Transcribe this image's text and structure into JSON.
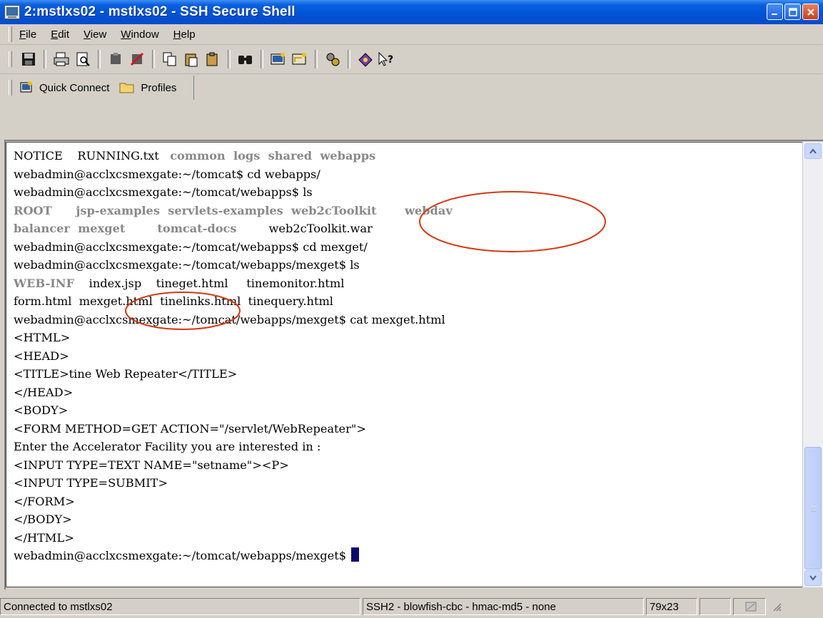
{
  "window": {
    "title": "2:mstlxs02 - mstlxs02 - SSH Secure Shell",
    "buttons": [
      "minimize",
      "maximize",
      "close"
    ]
  },
  "menu": [
    {
      "label": "File",
      "mnemonic": "F",
      "rest": "ile"
    },
    {
      "label": "Edit",
      "mnemonic": "E",
      "rest": "dit"
    },
    {
      "label": "View",
      "mnemonic": "V",
      "rest": "iew"
    },
    {
      "label": "Window",
      "mnemonic": "W",
      "rest": "indow"
    },
    {
      "label": "Help",
      "mnemonic": "H",
      "rest": "elp"
    }
  ],
  "toolbar_icons": [
    "save-icon",
    "print-icon",
    "print-preview-icon",
    "disconnect-icon",
    "terminate-icon",
    "copy-icon",
    "paste-icon",
    "paste-special-icon",
    "find-icon",
    "new-terminal-icon",
    "new-file-transfer-icon",
    "settings-icon",
    "help-icon",
    "context-help-icon"
  ],
  "quick_connect": {
    "quick_connect_label": "Quick Connect",
    "profiles_label": "Profiles"
  },
  "terminal": {
    "lines": [
      [
        {
          "t": "NOTICE    RUNNING.txt   "
        },
        {
          "t": "common  logs  shared  webapps",
          "c": "gray"
        }
      ],
      [
        {
          "t": "webadmin@acclxcsmexgate:~/tomcat$ cd webapps/"
        }
      ],
      [
        {
          "t": "webadmin@acclxcsmexgate:~/tomcat/webapps$ ls"
        }
      ],
      [
        {
          "t": "ROOT      jsp-examples  servlets-examples  web2cToolkit       webdav",
          "c": "gray"
        }
      ],
      [
        {
          "t": "balancer  mexget        tomcat-docs        ",
          "c": "gray"
        },
        {
          "t": "web2cToolkit.war"
        }
      ],
      [
        {
          "t": "webadmin@acclxcsmexgate:~/tomcat/webapps$ cd mexget/"
        }
      ],
      [
        {
          "t": "webadmin@acclxcsmexgate:~/tomcat/webapps/mexget$ ls"
        }
      ],
      [
        {
          "t": "WEB-INF",
          "c": "gray"
        },
        {
          "t": "    index.jsp    tineget.html     tinemonitor.html"
        }
      ],
      [
        {
          "t": "form.html  mexget.html  tinelinks.html  tinequery.html"
        }
      ],
      [
        {
          "t": "webadmin@acclxcsmexgate:~/tomcat/webapps/mexget$ cat mexget.html"
        }
      ],
      [
        {
          "t": "<HTML>"
        }
      ],
      [
        {
          "t": "<HEAD>"
        }
      ],
      [
        {
          "t": "<TITLE>tine Web Repeater</TITLE>"
        }
      ],
      [
        {
          "t": "</HEAD>"
        }
      ],
      [
        {
          "t": "<BODY>"
        }
      ],
      [
        {
          "t": "<FORM METHOD=GET ACTION=\"/servlet/WebRepeater\">"
        }
      ],
      [
        {
          "t": "Enter the Accelerator Facility you are interested in :"
        }
      ],
      [
        {
          "t": "<INPUT TYPE=TEXT NAME=\"setname\"><P>"
        }
      ],
      [
        {
          "t": "<INPUT TYPE=SUBMIT>"
        }
      ],
      [
        {
          "t": "</FORM>"
        }
      ],
      [
        {
          "t": "</BODY>"
        }
      ],
      [
        {
          "t": "</HTML>"
        }
      ],
      [
        {
          "t": "webadmin@acclxcsmexgate:~/tomcat/webapps/mexget$ "
        }
      ]
    ]
  },
  "status": {
    "connection": "Connected to mstlxs02",
    "cipher": "SSH2 - blowfish-cbc - hmac-md5 - none",
    "size": "79x23"
  },
  "colors": {
    "titlebar": "#0052d6",
    "annotation": "#d23a14",
    "cursor": "#0a0a6e"
  }
}
